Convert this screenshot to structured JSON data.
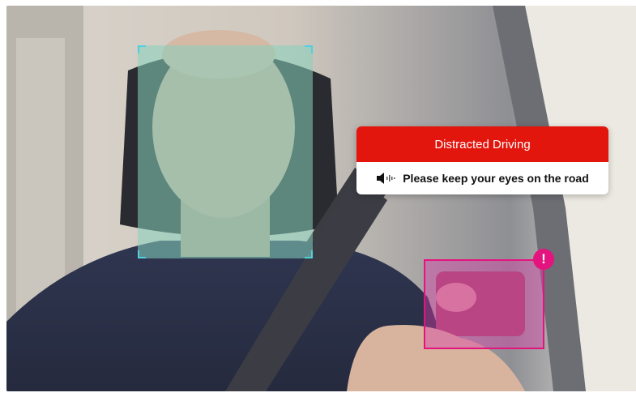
{
  "alert": {
    "title": "Distracted Driving",
    "message": "Please keep your eyes on the road",
    "header_color": "#e3160e",
    "icon": "speaker-sound-icon"
  },
  "detections": {
    "face": {
      "label": "face-detection",
      "color": "#4fd0e0"
    },
    "phone": {
      "label": "phone-detection",
      "color": "#e4147f",
      "badge_text": "!"
    }
  }
}
